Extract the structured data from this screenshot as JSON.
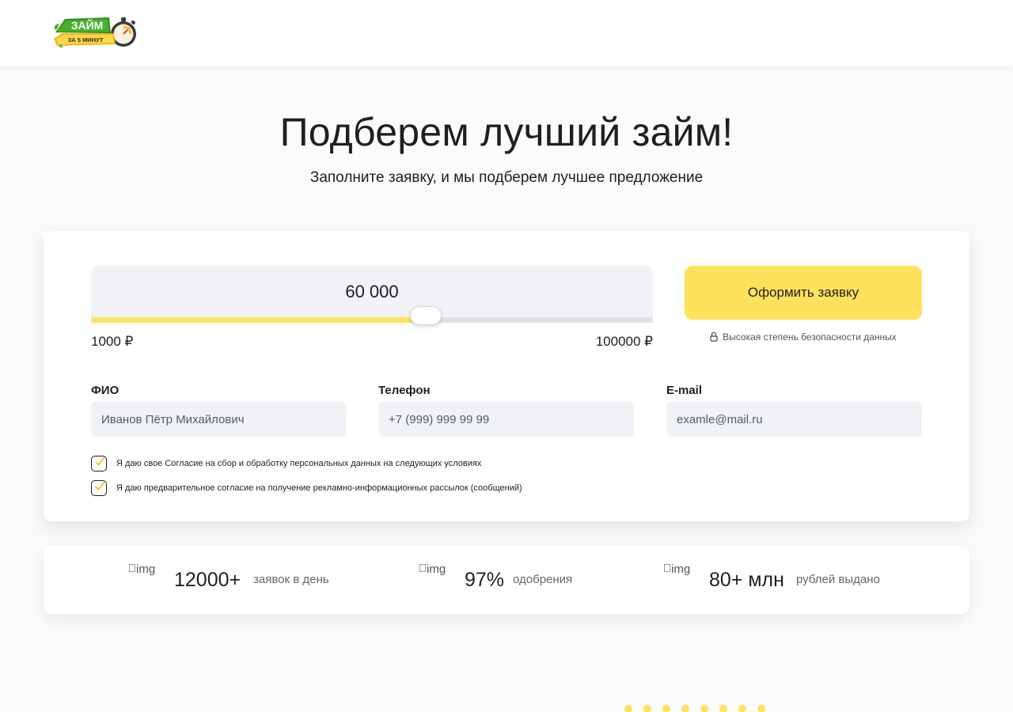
{
  "header": {
    "logo": {
      "title": "ЗАЙМ",
      "subtitle": "ЗА 5 МИНУТ"
    }
  },
  "hero": {
    "title": "Подберем лучший займ!",
    "subtitle": "Заполните заявку, и мы подберем лучшее предложение"
  },
  "form": {
    "amount": {
      "value": "60 000",
      "value_number": 60000,
      "min_label": "1000 ₽",
      "max_label": "100000 ₽",
      "min": 1000,
      "max": 100000
    },
    "submit_label": "Оформить заявку",
    "secure_note": "Высокая степень безопасности данных",
    "fields": {
      "name": {
        "label": "ФИО",
        "placeholder": "Иванов Пётр Михайлович"
      },
      "phone": {
        "label": "Телефон",
        "placeholder": "+7 (999) 999 99 99"
      },
      "email": {
        "label": "E-mail",
        "placeholder": "examle@mail.ru"
      }
    },
    "consents": [
      {
        "text": "Я даю свое Согласие на сбор и обработку персональных данных на следующих условиях",
        "checked": true
      },
      {
        "text": "Я даю предварительное согласие на получение рекламно-информационных рассылок (сообщений)",
        "checked": true
      }
    ]
  },
  "stats": [
    {
      "img_alt": "img",
      "number": "12000+",
      "label": "заявок в день"
    },
    {
      "img_alt": "img",
      "number": "97%",
      "label": "одобрения"
    },
    {
      "img_alt": "img",
      "number": "80+ млн",
      "label": "рублей выдано"
    }
  ],
  "colors": {
    "accent": "#ffe25c",
    "input_bg": "#f0f2f6",
    "text": "#1f1f1f"
  }
}
